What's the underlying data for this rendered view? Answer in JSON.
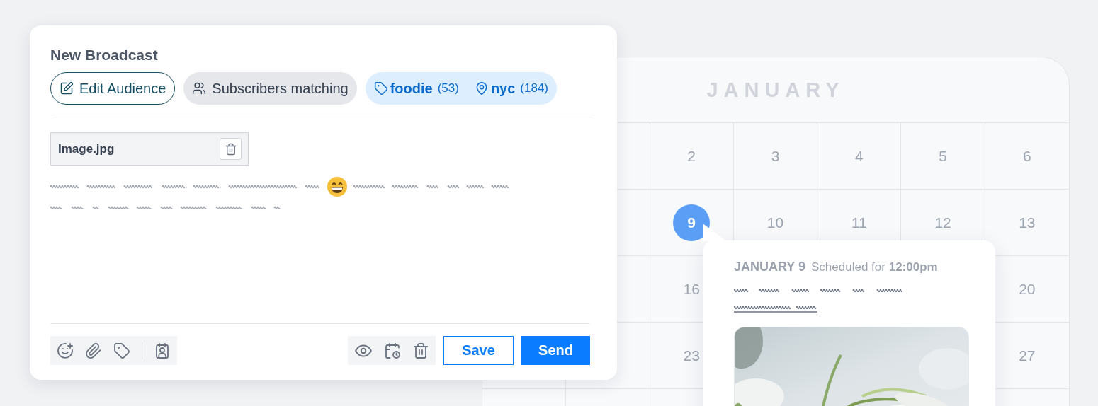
{
  "composer": {
    "title": "New Broadcast",
    "audience": {
      "edit_label": "Edit Audience",
      "matching_label": "Subscribers matching",
      "filters": [
        {
          "kind": "tag",
          "name": "foodie",
          "count": "(53)"
        },
        {
          "kind": "location",
          "name": "nyc",
          "count": "(184)"
        }
      ]
    },
    "attachment": {
      "filename": "Image.jpg"
    },
    "actions": [
      {
        "kind": "outline",
        "label": "Save"
      },
      {
        "kind": "primary",
        "label": "Send"
      }
    ]
  },
  "calendar": {
    "month": "JANUARY",
    "weeks": [
      {
        "days": [
          {
            "kind": "covered"
          },
          {
            "kind": "blank"
          },
          {
            "kind": "day",
            "day": "2",
            "selected": false
          },
          {
            "kind": "day",
            "day": "3",
            "selected": false
          },
          {
            "kind": "day",
            "day": "4",
            "selected": false
          },
          {
            "kind": "day",
            "day": "5",
            "selected": false
          },
          {
            "kind": "day",
            "day": "6",
            "selected": false
          }
        ]
      },
      {
        "days": [
          {
            "kind": "covered"
          },
          {
            "kind": "blank"
          },
          {
            "kind": "day",
            "day": "9",
            "selected": true
          },
          {
            "kind": "day",
            "day": "10",
            "selected": false
          },
          {
            "kind": "day",
            "day": "11",
            "selected": false
          },
          {
            "kind": "day",
            "day": "12",
            "selected": false
          },
          {
            "kind": "day",
            "day": "13",
            "selected": false
          }
        ]
      },
      {
        "days": [
          {
            "kind": "covered"
          },
          {
            "kind": "blank"
          },
          {
            "kind": "day",
            "day": "16",
            "selected": false
          },
          {
            "kind": "covered"
          },
          {
            "kind": "blank"
          },
          {
            "kind": "blank"
          },
          {
            "kind": "day",
            "day": "20",
            "selected": false
          }
        ]
      },
      {
        "days": [
          {
            "kind": "blank"
          },
          {
            "kind": "blank"
          },
          {
            "kind": "day",
            "day": "23",
            "selected": false
          },
          {
            "kind": "blank"
          },
          {
            "kind": "blank"
          },
          {
            "kind": "blank"
          },
          {
            "kind": "day",
            "day": "27",
            "selected": false
          }
        ]
      },
      {
        "days": [
          {
            "kind": "blank"
          },
          {
            "kind": "blank"
          },
          {
            "kind": "blank"
          },
          {
            "kind": "blank"
          },
          {
            "kind": "blank"
          },
          {
            "kind": "blank"
          },
          {
            "kind": "blank"
          }
        ]
      }
    ]
  },
  "popover": {
    "date": "JANUARY 9",
    "scheduled": "Scheduled for **12:00pm**"
  }
}
